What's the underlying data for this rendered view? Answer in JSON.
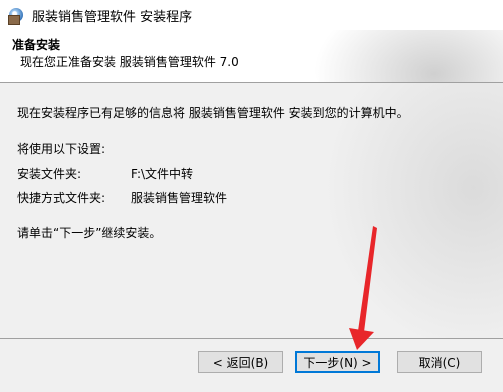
{
  "window": {
    "title": "服装销售管理软件 安装程序"
  },
  "header": {
    "title": "准备安装",
    "subtitle": "现在您正准备安装 服装销售管理软件 7.0"
  },
  "main": {
    "intro": "现在安装程序已有足够的信息将 服装销售管理软件 安装到您的计算机中。",
    "settings_label": "将使用以下设置:",
    "install_folder_label": "安装文件夹:",
    "install_folder_value": "F:\\文件中转",
    "shortcut_folder_label": "快捷方式文件夹:",
    "shortcut_folder_value": "服装销售管理软件",
    "continue_hint": "请单击“下一步”继续安装。"
  },
  "buttons": {
    "back": "< 返回(B)",
    "next": "下一步(N) >",
    "cancel": "取消(C)"
  },
  "colors": {
    "annotation_arrow": "#e8262a",
    "focus_border": "#0078d7"
  }
}
